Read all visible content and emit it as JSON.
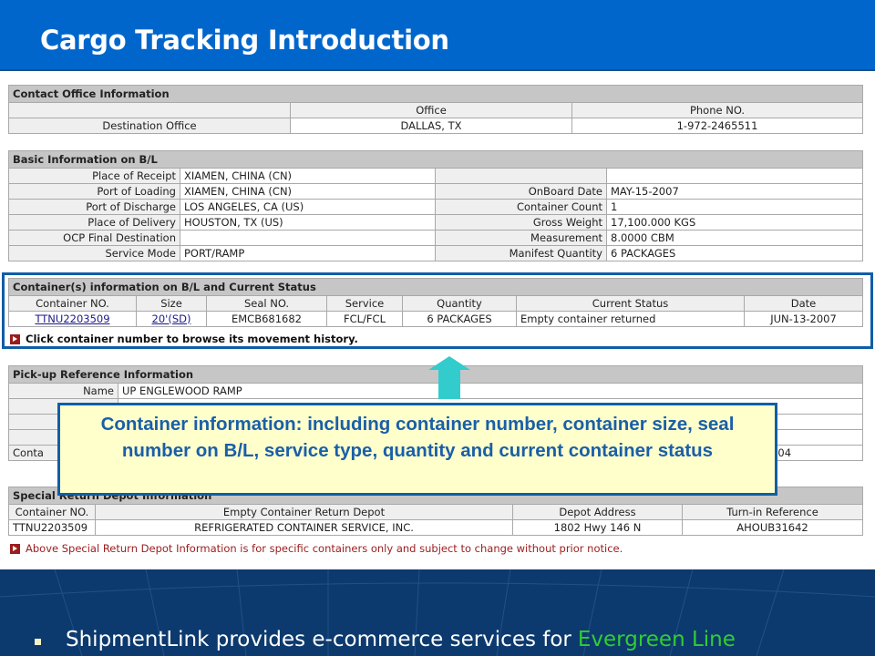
{
  "slide": {
    "title": "Cargo Tracking Introduction"
  },
  "contact_office": {
    "section_title": "Contact Office Information",
    "headers": [
      "",
      "Office",
      "Phone NO."
    ],
    "row": {
      "label": "Destination Office",
      "office": "DALLAS, TX",
      "phone": "1-972-2465511"
    }
  },
  "basic_info": {
    "section_title": "Basic Information on B/L",
    "rows": [
      {
        "label_left": "Place of Receipt",
        "value_left": "XIAMEN, CHINA (CN)",
        "label_right": "",
        "value_right": ""
      },
      {
        "label_left": "Port of Loading",
        "value_left": "XIAMEN, CHINA (CN)",
        "label_right": "OnBoard Date",
        "value_right": "MAY-15-2007"
      },
      {
        "label_left": "Port of Discharge",
        "value_left": "LOS ANGELES, CA (US)",
        "label_right": "Container Count",
        "value_right": "1"
      },
      {
        "label_left": "Place of Delivery",
        "value_left": "HOUSTON, TX (US)",
        "label_right": "Gross Weight",
        "value_right": "17,100.000 KGS"
      },
      {
        "label_left": "OCP Final Destination",
        "value_left": "",
        "label_right": "Measurement",
        "value_right": "8.0000 CBM"
      },
      {
        "label_left": "Service Mode",
        "value_left": "PORT/RAMP",
        "label_right": "Manifest Quantity",
        "value_right": "6 PACKAGES"
      }
    ]
  },
  "containers": {
    "section_title": "Container(s) information on B/L and Current Status",
    "headers": [
      "Container NO.",
      "Size",
      "Seal NO.",
      "Service",
      "Quantity",
      "Current Status",
      "Date"
    ],
    "rows": [
      {
        "container_no": "TTNU2203509",
        "size": "20'(SD)",
        "seal_no": "EMCB681682",
        "service": "FCL/FCL",
        "quantity": "6 PACKAGES",
        "status": "Empty container returned",
        "date": "JUN-13-2007"
      }
    ],
    "note": "Click container number to browse its movement history."
  },
  "pickup": {
    "section_title": "Pick-up Reference Information",
    "rows": [
      {
        "label": "Name",
        "value": "UP ENGLEWOOD RAMP"
      },
      {
        "label": "",
        "value": ""
      },
      {
        "label": "",
        "value": ""
      },
      {
        "label": "",
        "value": ""
      },
      {
        "label": "Conta",
        "value": "04"
      }
    ]
  },
  "special_return": {
    "section_title": "Special Return Depot Information",
    "headers": [
      "Container NO.",
      "Empty Container Return Depot",
      "Depot Address",
      "Turn-in Reference"
    ],
    "rows": [
      {
        "container_no": "TTNU2203509",
        "depot": "REFRIGERATED CONTAINER SERVICE, INC.",
        "address": "1802 Hwy 146 N",
        "reference": "AHOUB31642"
      }
    ],
    "note": "Above Special Return Depot Information is for specific containers only and subject to change without prior notice."
  },
  "callout": {
    "text": "Container information: including container number, container size, seal number on B/L, service type, quantity and current container status"
  },
  "footer": {
    "text": "ShipmentLink provides e-commerce services for",
    "brand": "Evergreen Line"
  },
  "colors": {
    "title_bar": "#0066cc",
    "highlight_border": "#0f5ea8",
    "callout_bg": "#ffffcc",
    "callout_text": "#1a5fa8",
    "arrow": "#33cccc",
    "note_red": "#9b1c1c",
    "footer_bg": "#0c3a6e",
    "brand_green": "#33cc33"
  }
}
